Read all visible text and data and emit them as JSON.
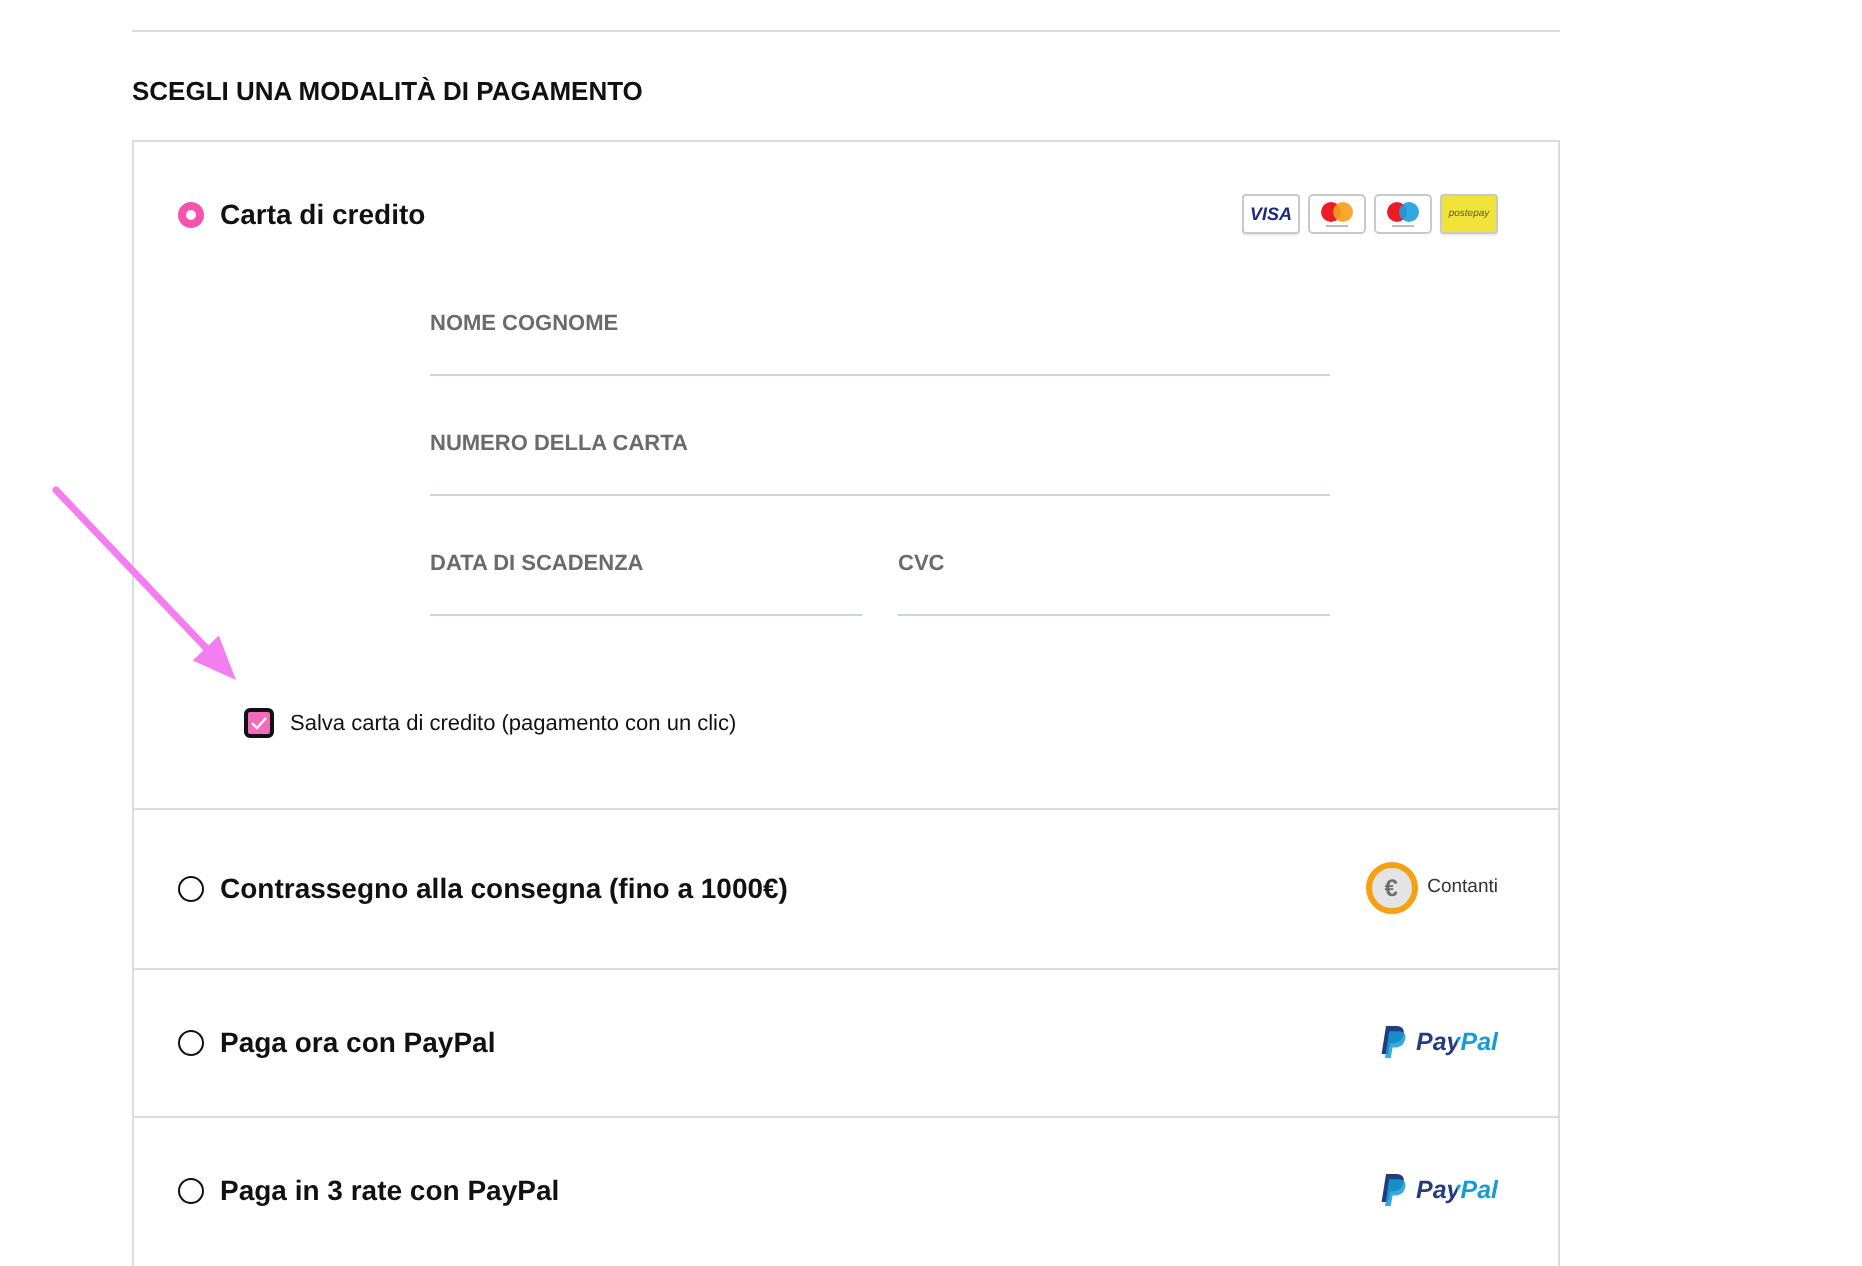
{
  "heading": "SCEGLI UNA MODALITÀ DI PAGAMENTO",
  "payment_methods": [
    {
      "kind": "card",
      "label": "Carta di credito",
      "selected": true,
      "card_logos": [
        {
          "kind": "visa",
          "text": "VISA"
        },
        {
          "kind": "mastercard"
        },
        {
          "kind": "maestro"
        },
        {
          "kind": "postepay",
          "text": "postepay"
        }
      ],
      "form_rows": [
        [
          {
            "label": "NOME COGNOME"
          }
        ],
        [
          {
            "label": "NUMERO DELLA CARTA"
          }
        ],
        [
          {
            "label": "DATA DI SCADENZA"
          },
          {
            "label": "CVC"
          }
        ]
      ],
      "save_card": {
        "label": "Salva carta di credito (pagamento con un clic)",
        "checked": true
      }
    },
    {
      "kind": "cash",
      "label": "Contrassegno alla consegna (fino a 1000€)",
      "selected": false,
      "badge": {
        "symbol": "€",
        "text": "Contanti"
      }
    },
    {
      "kind": "paypal",
      "label": "Paga ora con PayPal",
      "selected": false,
      "logo_text": "PayPal"
    },
    {
      "kind": "paypal",
      "label": "Paga in 3 rate con PayPal",
      "selected": false,
      "logo_text": "PayPal"
    }
  ]
}
